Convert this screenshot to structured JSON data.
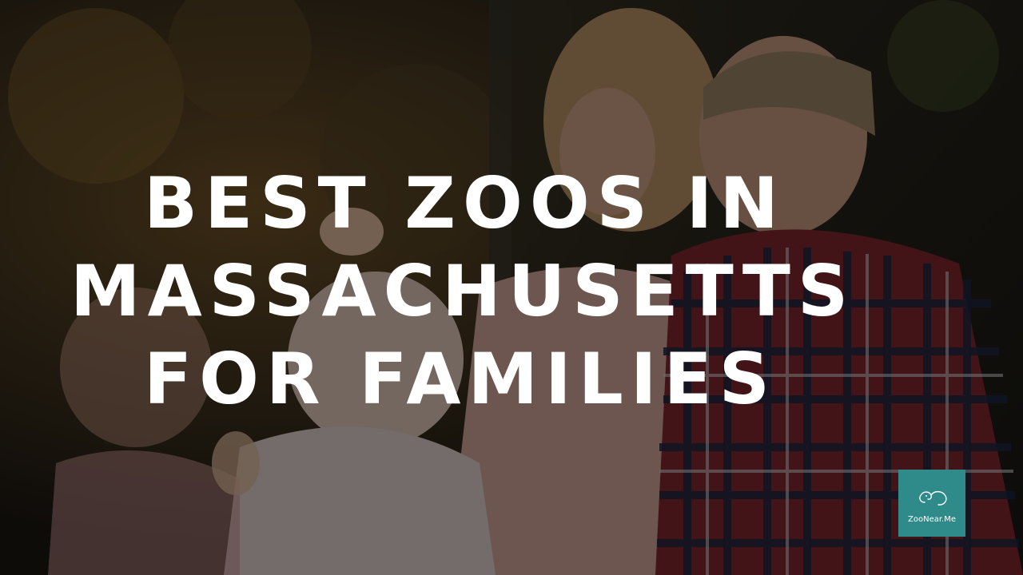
{
  "headline": {
    "line1": "BEST ZOOS IN",
    "line2": "MASSACHUSETTS",
    "line3": "FOR FAMILIES"
  },
  "logo": {
    "text": "ZooNear.Me",
    "icon": "elephant-mark-icon",
    "background_color": "#2f8a8a"
  },
  "photo": {
    "subject": "mother-with-children-at-zoo-exhibit",
    "overlay_color": "#000000"
  },
  "colors": {
    "title_text": "#ffffff"
  }
}
